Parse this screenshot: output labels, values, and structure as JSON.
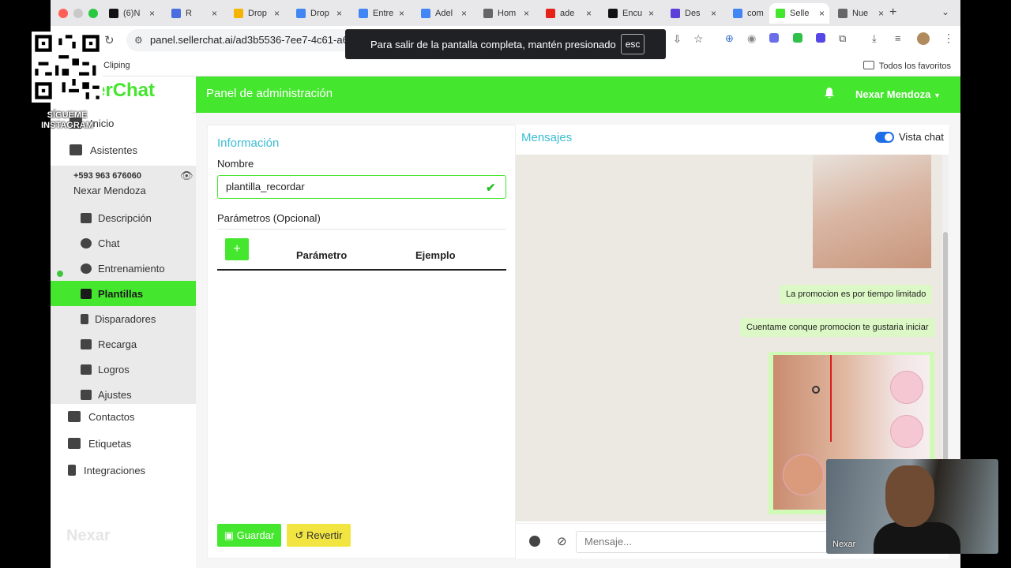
{
  "browser": {
    "tabs": [
      {
        "label": "(6)N",
        "fav": "#111"
      },
      {
        "label": "R",
        "fav": "#4a6ee0"
      },
      {
        "label": "Drop",
        "fav": "#f4b400"
      },
      {
        "label": "Drop",
        "fav": "#4285f4"
      },
      {
        "label": "Entre",
        "fav": "#4285f4"
      },
      {
        "label": "Adel",
        "fav": "#4285f4"
      },
      {
        "label": "Hom",
        "fav": "#666"
      },
      {
        "label": "ade",
        "fav": "#e62117"
      },
      {
        "label": "Encu",
        "fav": "#111"
      },
      {
        "label": "Des",
        "fav": "#5b3fd8"
      },
      {
        "label": "com",
        "fav": "#4285f4"
      },
      {
        "label": "Selle",
        "fav": "#45e62e"
      },
      {
        "label": "Nue",
        "fav": "#666"
      }
    ],
    "url": "panel.sellerchat.ai/ad3b5536-7ee7-4c61-a6e2",
    "bookmark_clip": "Cliping",
    "bookmark_all": "Todos los favoritos",
    "fullscreen_toast": "Para salir de la pantalla completa, mantén presionado",
    "fullscreen_key": "esc"
  },
  "overlay": {
    "qr_label_line1": "SÍGUEME",
    "qr_label_line2": "INSTAGRAM",
    "webcam_name": "Nexar"
  },
  "sidebar": {
    "logo": "erChat",
    "items_top": [
      {
        "label": "Inicio",
        "icon": "home-icon"
      },
      {
        "label": "Asistentes",
        "icon": "robot-icon"
      }
    ],
    "account": {
      "phone": "+593 963 676060",
      "name": "Nexar Mendoza"
    },
    "sub_items": [
      {
        "label": "Descripción",
        "icon": "chart-icon"
      },
      {
        "label": "Chat",
        "icon": "chat-icon"
      },
      {
        "label": "Entrenamiento",
        "icon": "brain-icon"
      },
      {
        "label": "Plantillas",
        "icon": "layers-icon"
      },
      {
        "label": "Disparadores",
        "icon": "bolt-icon"
      },
      {
        "label": "Recarga",
        "icon": "money-icon"
      },
      {
        "label": "Logros",
        "icon": "trophy-icon"
      },
      {
        "label": "Ajustes",
        "icon": "wrench-icon"
      }
    ],
    "items_bottom": [
      {
        "label": "Contactos",
        "icon": "contact-icon"
      },
      {
        "label": "Etiquetas",
        "icon": "tags-icon"
      },
      {
        "label": "Integraciones",
        "icon": "plug-icon"
      }
    ],
    "footer_brand": "Nexar"
  },
  "header": {
    "title": "Panel de administración",
    "user": "Nexar Mendoza"
  },
  "info": {
    "title": "Información",
    "name_label": "Nombre",
    "name_value": "plantilla_recordar",
    "params_label": "Parámetros (Opcional)",
    "col_param": "Parámetro",
    "col_example": "Ejemplo",
    "add_label": "+",
    "save_label": "Guardar",
    "revert_label": "Revertir"
  },
  "chat": {
    "title": "Mensajes",
    "toggle_label": "Vista chat",
    "messages": [
      "La promocion es por tiempo limitado",
      "Cuentame conque promocion te gustaria iniciar"
    ],
    "input_placeholder": "Mensaje..."
  }
}
